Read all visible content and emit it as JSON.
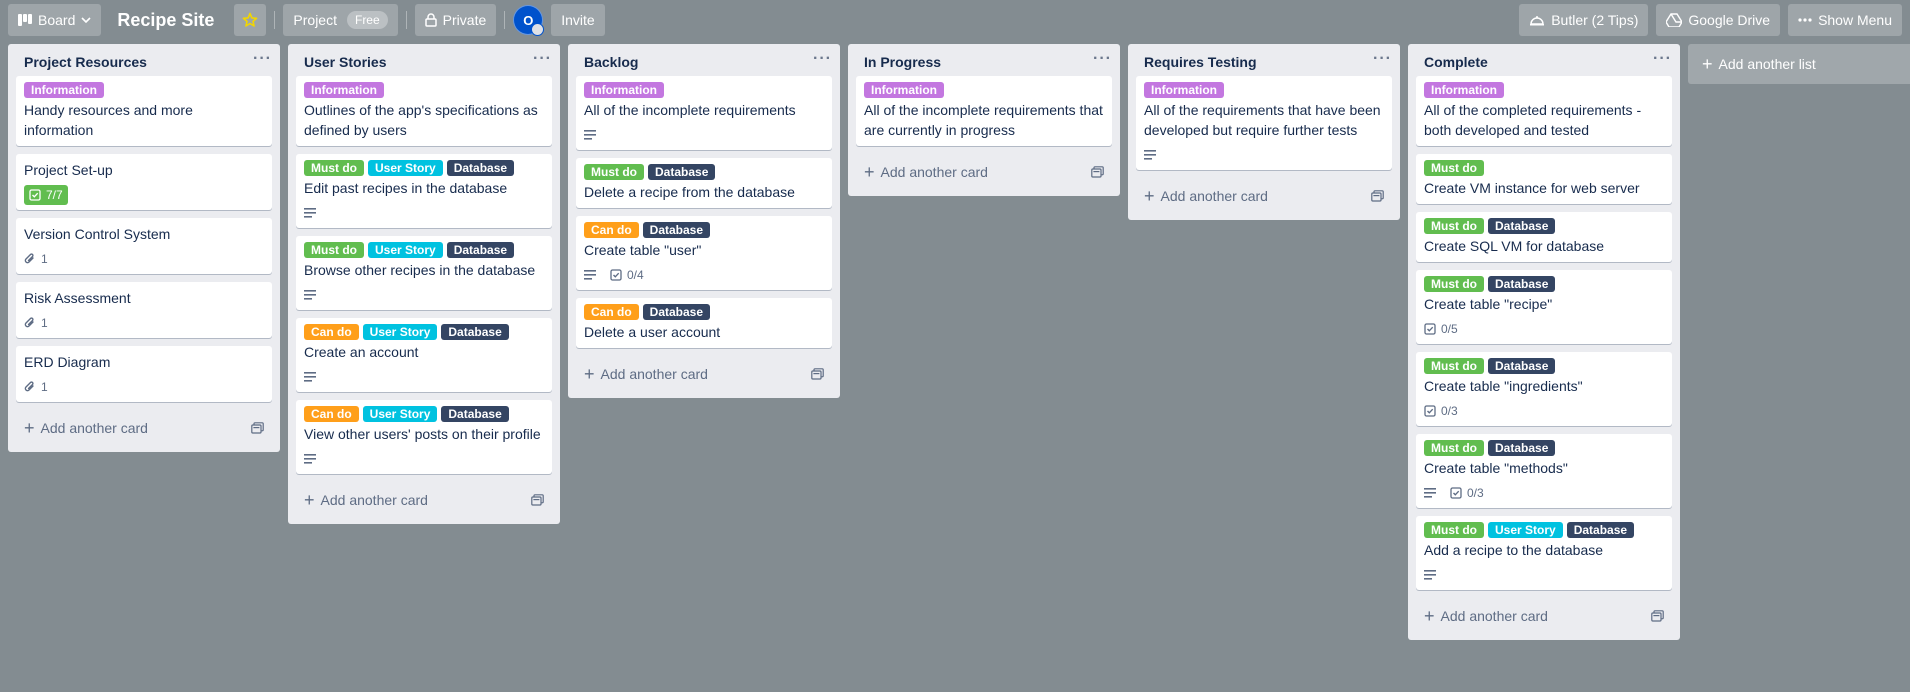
{
  "header": {
    "board_switcher": "Board",
    "title": "Recipe Site",
    "project_label": "Project",
    "free_label": "Free",
    "visibility": "Private",
    "avatar_initial": "O",
    "invite": "Invite",
    "butler": "Butler (2 Tips)",
    "drive": "Google Drive",
    "menu": "Show Menu"
  },
  "colors": {
    "purple": "#c377e0",
    "green": "#61bd4f",
    "sky": "#00c2e0",
    "navy": "#344563",
    "orange": "#ff9f1a",
    "background": "#838c91"
  },
  "footer": {
    "add_card": "Add another card"
  },
  "add_list": "Add another list",
  "lists": [
    {
      "title": "Project Resources",
      "cards": [
        {
          "labels": [
            "Information"
          ],
          "title": "Handy resources and more information",
          "badges": []
        },
        {
          "labels": [],
          "title": "Project Set-up",
          "badges": [
            {
              "type": "checklist-done",
              "text": "7/7"
            }
          ]
        },
        {
          "labels": [],
          "title": "Version Control System",
          "badges": [
            {
              "type": "attachment",
              "text": "1"
            }
          ]
        },
        {
          "labels": [],
          "title": "Risk Assessment",
          "badges": [
            {
              "type": "attachment",
              "text": "1"
            }
          ]
        },
        {
          "labels": [],
          "title": "ERD Diagram",
          "badges": [
            {
              "type": "attachment",
              "text": "1"
            }
          ]
        }
      ]
    },
    {
      "title": "User Stories",
      "cards": [
        {
          "labels": [
            "Information"
          ],
          "title": "Outlines of the app's specifications as defined by users",
          "badges": []
        },
        {
          "labels": [
            "Must do",
            "User Story",
            "Database"
          ],
          "title": "Edit past recipes in the database",
          "badges": [
            {
              "type": "description",
              "text": ""
            }
          ]
        },
        {
          "labels": [
            "Must do",
            "User Story",
            "Database"
          ],
          "title": "Browse other recipes in the database",
          "badges": [
            {
              "type": "description",
              "text": ""
            }
          ]
        },
        {
          "labels": [
            "Can do",
            "User Story",
            "Database"
          ],
          "title": "Create an account",
          "badges": [
            {
              "type": "description",
              "text": ""
            }
          ]
        },
        {
          "labels": [
            "Can do",
            "User Story",
            "Database"
          ],
          "title": "View other users' posts on their profile",
          "badges": [
            {
              "type": "description",
              "text": ""
            }
          ]
        }
      ]
    },
    {
      "title": "Backlog",
      "cards": [
        {
          "labels": [
            "Information"
          ],
          "title": "All of the incomplete requirements",
          "badges": [
            {
              "type": "description",
              "text": ""
            }
          ]
        },
        {
          "labels": [
            "Must do",
            "Database"
          ],
          "title": "Delete a recipe from the database",
          "badges": []
        },
        {
          "labels": [
            "Can do",
            "Database"
          ],
          "title": "Create table \"user\"",
          "badges": [
            {
              "type": "description",
              "text": ""
            },
            {
              "type": "checklist",
              "text": "0/4"
            }
          ]
        },
        {
          "labels": [
            "Can do",
            "Database"
          ],
          "title": "Delete a user account",
          "badges": []
        }
      ]
    },
    {
      "title": "In Progress",
      "cards": [
        {
          "labels": [
            "Information"
          ],
          "title": "All of the incomplete requirements that are currently in progress",
          "badges": []
        }
      ]
    },
    {
      "title": "Requires Testing",
      "cards": [
        {
          "labels": [
            "Information"
          ],
          "title": "All of the requirements that have been developed but require further tests",
          "badges": [
            {
              "type": "description",
              "text": ""
            }
          ]
        }
      ]
    },
    {
      "title": "Complete",
      "cards": [
        {
          "labels": [
            "Information"
          ],
          "title": "All of the completed requirements - both developed and tested",
          "badges": []
        },
        {
          "labels": [
            "Must do"
          ],
          "title": "Create VM instance for web server",
          "badges": []
        },
        {
          "labels": [
            "Must do",
            "Database"
          ],
          "title": "Create SQL VM for database",
          "badges": []
        },
        {
          "labels": [
            "Must do",
            "Database"
          ],
          "title": "Create table \"recipe\"",
          "badges": [
            {
              "type": "checklist",
              "text": "0/5"
            }
          ]
        },
        {
          "labels": [
            "Must do",
            "Database"
          ],
          "title": "Create table \"ingredients\"",
          "badges": [
            {
              "type": "checklist",
              "text": "0/3"
            }
          ]
        },
        {
          "labels": [
            "Must do",
            "Database"
          ],
          "title": "Create table \"methods\"",
          "badges": [
            {
              "type": "description",
              "text": ""
            },
            {
              "type": "checklist",
              "text": "0/3"
            }
          ]
        },
        {
          "labels": [
            "Must do",
            "User Story",
            "Database"
          ],
          "title": "Add a recipe to the database",
          "badges": [
            {
              "type": "description",
              "text": ""
            }
          ]
        }
      ]
    }
  ]
}
